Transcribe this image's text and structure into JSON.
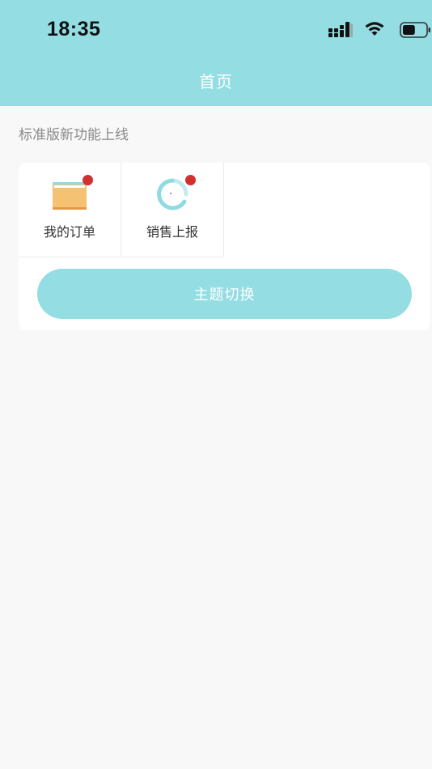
{
  "status_bar": {
    "time": "18:35",
    "icons": [
      "signal-icon",
      "wifi-icon",
      "battery-icon"
    ],
    "battery_level_percent": 55
  },
  "nav": {
    "title": "首页"
  },
  "notice": {
    "text": "标准版新功能上线"
  },
  "grid": {
    "items": [
      {
        "label": "我的订单",
        "icon": "folder-icon",
        "badge": true
      },
      {
        "label": "销售上报",
        "icon": "report-icon",
        "badge": true
      }
    ]
  },
  "theme_button": {
    "label": "主题切换"
  },
  "colors": {
    "header": "#93dde3",
    "button": "#93dde3",
    "badge": "#d2302f",
    "folder": "#f5c274",
    "background": "#f8f8f8"
  }
}
